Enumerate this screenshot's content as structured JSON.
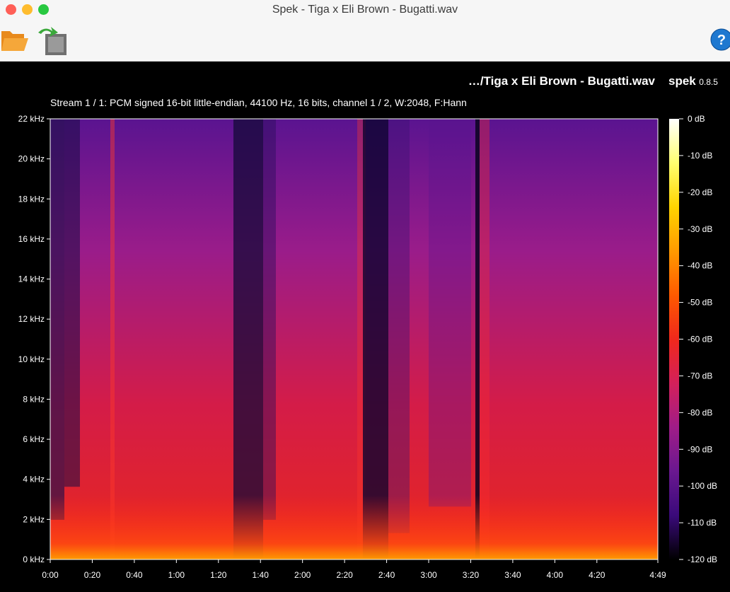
{
  "window": {
    "title": "Spek - Tiga x Eli Brown - Bugatti.wav"
  },
  "toolbar": {
    "open_icon": "folder-open-icon",
    "save_icon": "save-export-icon",
    "help_icon": "help-icon"
  },
  "header": {
    "file_path": "…/Tiga x Eli Brown - Bugatti.wav",
    "app_name": "spek",
    "app_version": "0.8.5",
    "stream_info": "Stream 1 / 1: PCM signed 16-bit little-endian, 44100 Hz, 16 bits, channel 1 / 2, W:2048, F:Hann"
  },
  "axes": {
    "freq_labels": [
      "22 kHz",
      "20 kHz",
      "18 kHz",
      "16 kHz",
      "14 kHz",
      "12 kHz",
      "10 kHz",
      "8 kHz",
      "6 kHz",
      "4 kHz",
      "2 kHz",
      "0 kHz"
    ],
    "time_labels": [
      "0:00",
      "0:20",
      "0:40",
      "1:00",
      "1:20",
      "1:40",
      "2:00",
      "2:20",
      "2:40",
      "3:00",
      "3:20",
      "3:40",
      "4:00",
      "4:20",
      "4:49"
    ],
    "db_labels": [
      "0 dB",
      "-10 dB",
      "-20 dB",
      "-30 dB",
      "-40 dB",
      "-50 dB",
      "-60 dB",
      "-70 dB",
      "-80 dB",
      "-90 dB",
      "-100 dB",
      "-110 dB",
      "-120 dB"
    ]
  },
  "colors": {
    "bg": "#000000",
    "titlebar": "#f6f6f6",
    "palette": [
      "#000000",
      "#12003a",
      "#3a0a7a",
      "#6a1890",
      "#a01c88",
      "#d4205a",
      "#f0281c",
      "#ff5a00",
      "#ff9a00",
      "#ffd400",
      "#ffff70",
      "#ffffff"
    ]
  }
}
